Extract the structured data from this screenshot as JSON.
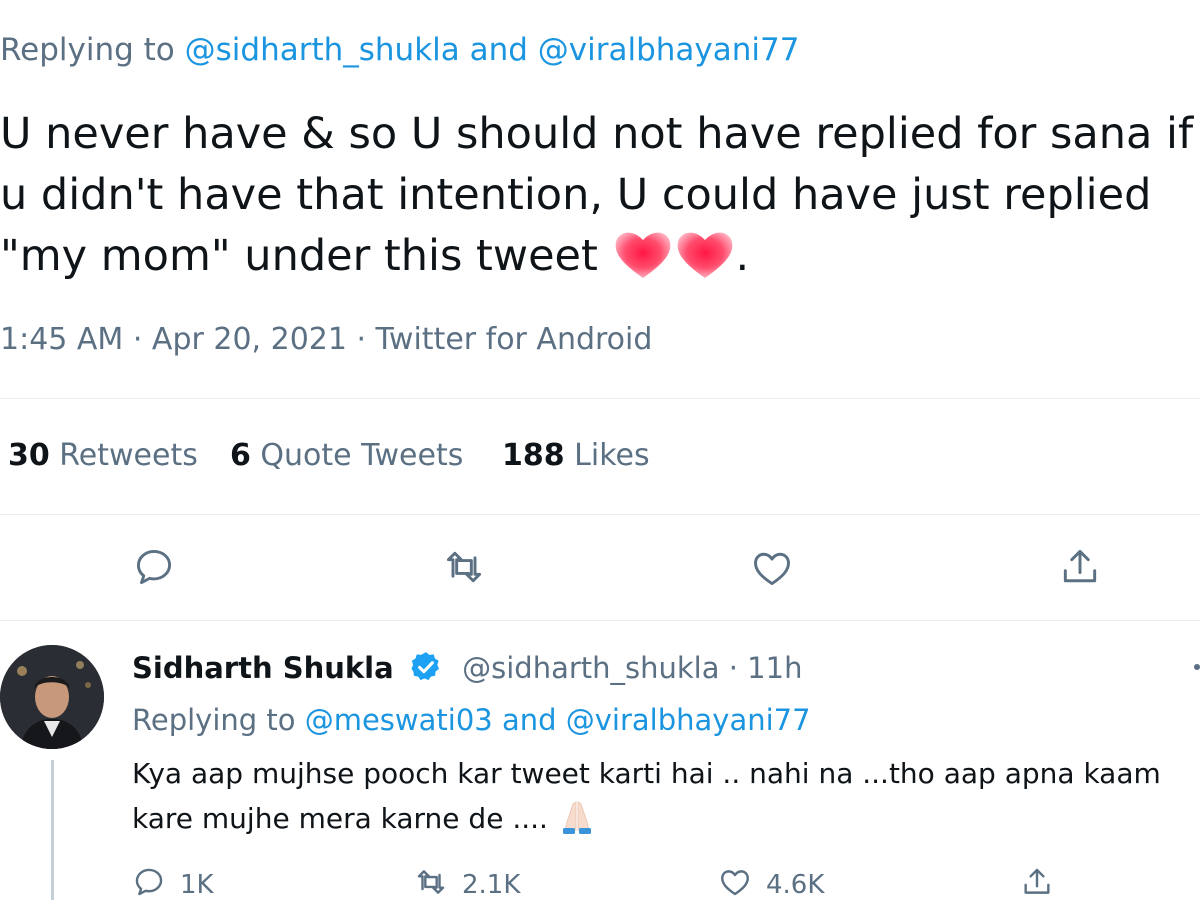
{
  "main_tweet": {
    "replying_prefix": "Replying to ",
    "reply_user_1": "@sidharth_shukla",
    "reply_and": " and ",
    "reply_user_2": "@viralbhayani77",
    "text_line_1": "U never have & so U should not have replied for sana if",
    "text_line_2": "u didn't have that intention, U could have just replied",
    "text_line_3": "\"my mom\" under this tweet",
    "text_line_3_end": ".",
    "emoji": "heart-emoji",
    "meta": "1:45 AM · Apr 20, 2021 · Twitter for Android",
    "stats": {
      "retweets_count": "30",
      "retweets_label": " Retweets",
      "quotes_count": "6",
      "quotes_label": " Quote Tweets",
      "likes_count": "188",
      "likes_label": " Likes"
    },
    "actions": [
      "reply-icon",
      "retweet-icon",
      "like-icon",
      "share-icon"
    ]
  },
  "reply_tweet": {
    "name": "Sidharth Shukla",
    "verified": true,
    "handle": "@sidharth_shukla · 11h",
    "replying_prefix": "Replying to ",
    "reply_user_1": "@meswati03",
    "reply_and": " and ",
    "reply_user_2": "@viralbhayani77",
    "text_line_1": "Kya aap mujhse pooch kar tweet karti hai .. nahi na ...tho aap apna kaam",
    "text_line_2": "kare mujhe mera karne de ....",
    "emoji": "folded-hands-emoji",
    "counts": {
      "replies": "1K",
      "retweets": "2.1K",
      "likes": "4.6K"
    }
  },
  "colors": {
    "link": "#1b95e0",
    "secondary_text": "#5b7083",
    "primary_text": "#0f1419",
    "verified": "#1da1f2",
    "heart": "#e0245e"
  }
}
